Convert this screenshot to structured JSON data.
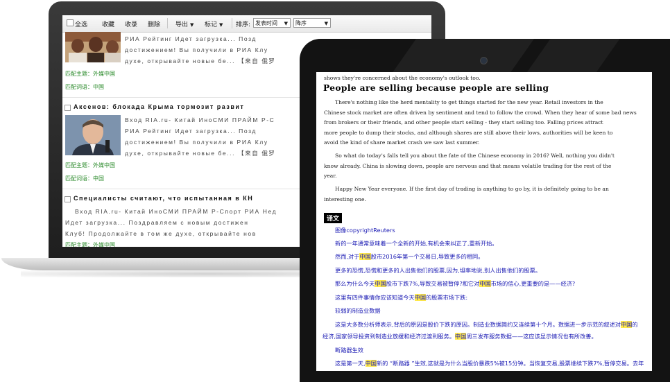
{
  "toolbar": {
    "select_all": "全选",
    "favorite": "收藏",
    "collect": "收录",
    "delete": "删除",
    "export": "导出",
    "mark": "标记",
    "sort_label": "排序:",
    "sort_field": "发表时间",
    "sort_order": "降序"
  },
  "articles": [
    {
      "lines": [
        "РИА Рейтинг Идет загрузка... Позд",
        "достижением! Вы получили в РИА Клу",
        "духе, открывайте новые бе...  【来自 俄罗"
      ],
      "tag1": "匹配主题：外媒中国",
      "tag2": "匹配词语：中国"
    },
    {
      "title": "Аксенов: блокада Крыма тормозит развит",
      "lines": [
        "Вход RIA.ru- Китай ИноСМИ ПРАЙМ Р-С",
        "РИА Рейтинг Идет загрузка... Позд",
        "достижением! Вы получили в РИА Клу",
        "духе, открывайте новые бе...  【来自 俄罗"
      ],
      "tag1": "匹配主题：外媒中国",
      "tag2": "匹配词语：中国"
    },
    {
      "title": "Специалисты считают, что испытанная в КН",
      "lines": [
        "Вход RIA.ru- Китай ИноСМИ ПРАЙМ Р-Спорт РИА Нед",
        "Идет загрузка... Поздравляем с новым достижен",
        "Клуб! Продолжайте в том же духе, открывайте нов"
      ],
      "tag1": "匹配主题：外媒中国"
    }
  ],
  "reader": {
    "top_line": "shows they're concerned about the economy's outlook too.",
    "heading": "People are selling because people are selling",
    "p1": [
      "There's nothing like the herd mentality to get things started for the new year. Retail investors in the",
      "Chinese stock market are often driven by sentiment and tend to follow the crowd. When they hear of some bad news",
      "from brokers or their friends, and other people start selling - they start selling too. Falling prices attract",
      "more people to dump their stocks, and although shares are still above their lows, authorities will be keen to",
      "avoid the kind of share market crash we saw last summer."
    ],
    "p2": [
      "So what do today's falls tell you about the fate of the Chinese economy in 2016? Well, nothing you didn't",
      "know already. China is slowing down, people are nervous and that means volatile trading for the rest of the",
      "year."
    ],
    "p3": [
      "Happy New Year everyone. If the first day of trading is anything to go by, it is definitely going to be an",
      "interesting one."
    ],
    "translation_label": "译文",
    "zh": {
      "l1": "图像copyrightReuters",
      "l2": "新的一年通常意味着一个全新的开始,有机会来纠正了,重新开始。",
      "l3a": "然而,对于",
      "l3b": "股市2016年第一个交易日,导致更多的相同。",
      "l4": "更多的恐慌,恐慌和更多的人出售他们的股票,因为,坦率地说,别人出售他们的股票。",
      "l5a": "那么为什么今天",
      "l5b": "股市下跌7%,导致交易被暂停?和它对",
      "l5c": "市场的信心,更重要的是——经济?",
      "l6a": "这里有四件事情你应该知道今天",
      "l6b": "的股票市场下跌:",
      "l7": "较弱的制造业数据",
      "l8a": "这是大多数分析师表示,背后的原因是股价下跌的原因。制造业数据简约又连续第十个月。数据进一步示范的叙述对",
      "l8b": "的",
      "l9a": "经济,国家领导投资到制造业放缓和经济过渡到服务。",
      "l9b": "周三发布服务数据——这应该显示情况也有所改善。",
      "l10": "断路器生效",
      "l11a": "这是第一天,",
      "l11b": "新的 “断路器 ”生效,这就是为什么当股价暴跌5%被15分钟。当恢复交易,股票继续下跌7%,暂停交易。去年",
      "hl_word": "中国"
    }
  }
}
